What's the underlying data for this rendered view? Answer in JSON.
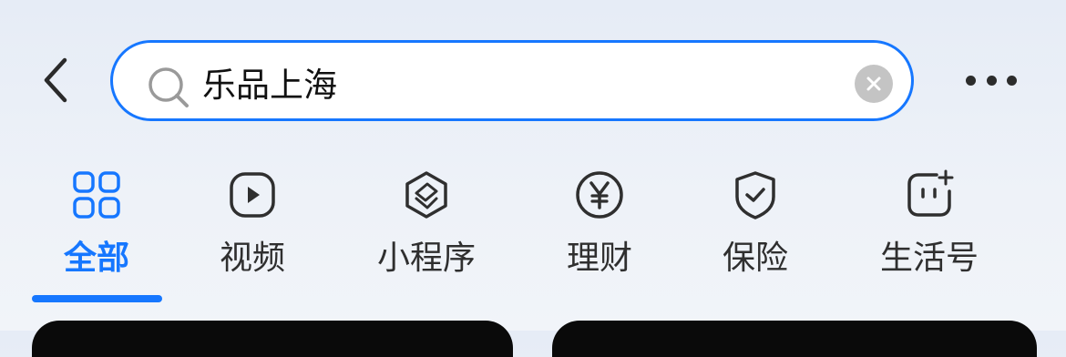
{
  "search": {
    "query": "乐品上海"
  },
  "tabs": [
    {
      "label": "全部",
      "icon": "grid-icon",
      "active": true
    },
    {
      "label": "视频",
      "icon": "play-icon",
      "active": false
    },
    {
      "label": "小程序",
      "icon": "mini-program-icon",
      "active": false
    },
    {
      "label": "理财",
      "icon": "yen-icon",
      "active": false
    },
    {
      "label": "保险",
      "icon": "shield-check-icon",
      "active": false
    },
    {
      "label": "生活号",
      "icon": "life-account-icon",
      "active": false
    }
  ],
  "colors": {
    "accent": "#1677ff",
    "icon_default": "#2f2f2f",
    "clear_button": "#c4c4c4",
    "background": "#eef2f8"
  }
}
